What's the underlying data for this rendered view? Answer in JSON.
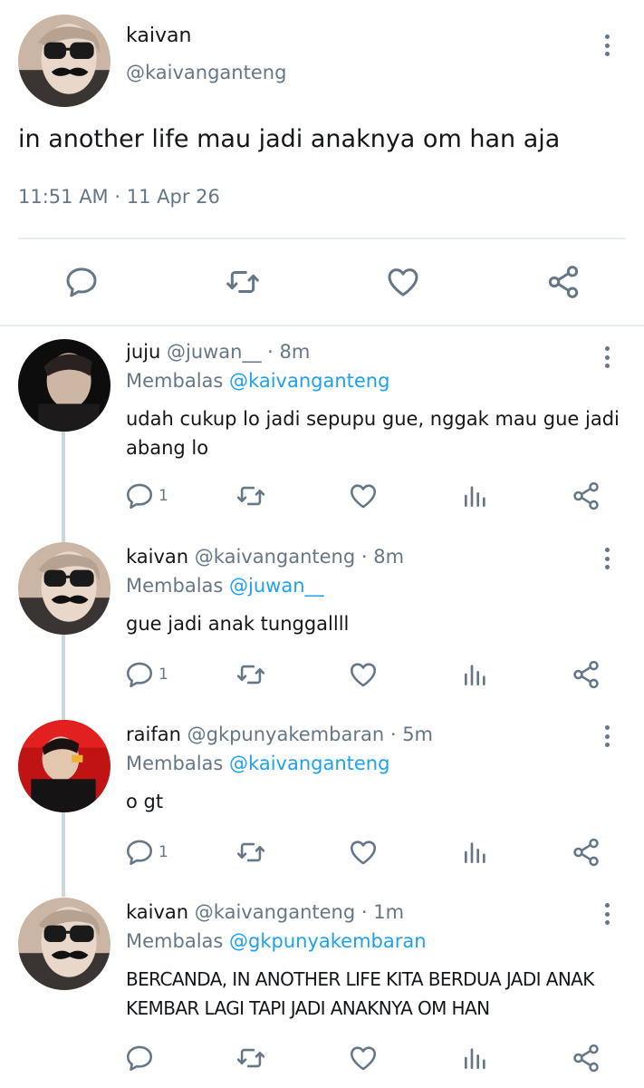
{
  "main_tweet": {
    "name": "kaivan",
    "handle": "@kaivanganteng",
    "text": "in another life mau jadi anaknya om han aja",
    "time": "11:51 AM",
    "separator": "·",
    "date": "11 Apr 26"
  },
  "replies": [
    {
      "name": "juju",
      "handle": "@juwan__",
      "age": "· 8m",
      "replying_prefix": "Membalas",
      "replying_to": "@kaivanganteng",
      "text": "udah cukup lo jadi sepupu gue, nggak mau gue jadi abang lo",
      "reply_count": "1"
    },
    {
      "name": "kaivan",
      "handle": "@kaivanganteng",
      "age": "· 8m",
      "replying_prefix": "Membalas",
      "replying_to": "@juwan__",
      "text": "gue jadi anak tunggallll",
      "reply_count": "1"
    },
    {
      "name": "raifan",
      "handle": "@gkpunyakembaran",
      "age": "· 5m",
      "replying_prefix": "Membalas",
      "replying_to": "@kaivanganteng",
      "text": "o gt",
      "reply_count": "1"
    },
    {
      "name": "kaivan",
      "handle": "@kaivanganteng",
      "age": "· 1m",
      "replying_prefix": "Membalas",
      "replying_to": "@gkpunyakembaran",
      "text": "BERCANDA, IN ANOTHER LIFE KITA BERDUA JADI ANAK KEMBAR LAGI TAPI JADI ANAKNYA OM HAN",
      "reply_count": ""
    }
  ],
  "icons": {
    "reply": "reply-icon",
    "retweet": "retweet-icon",
    "like": "heart-icon",
    "analytics": "analytics-icon",
    "share": "share-icon",
    "more": "more-vertical-icon"
  },
  "colors": {
    "text": "#14171a",
    "muted": "#657786",
    "link": "#1da1f2",
    "divider": "#e6ecf0",
    "thread_line": "#ccd6dd"
  }
}
